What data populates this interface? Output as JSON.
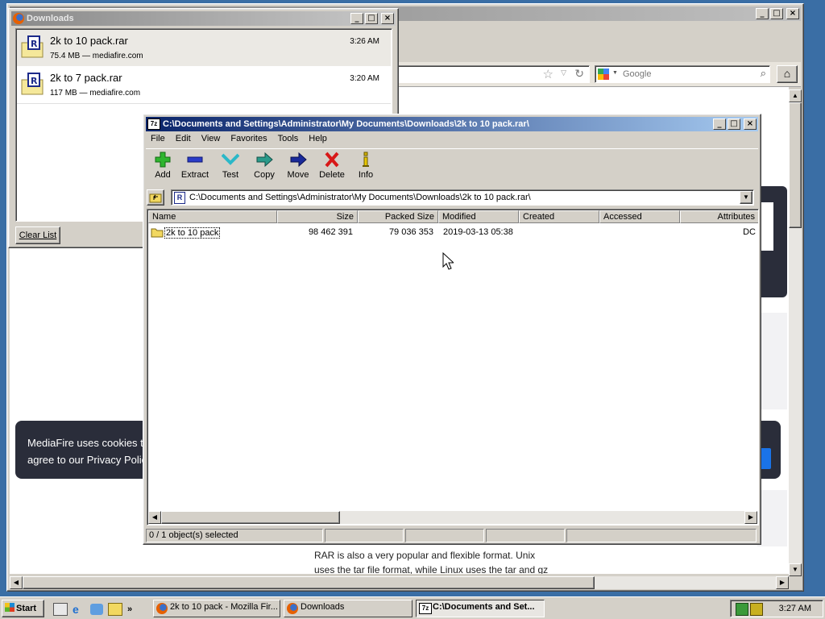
{
  "browser": {
    "search_placeholder": "Google",
    "cookie_line1": "MediaFire uses cookies t",
    "cookie_line2": "agree to our Privacy Polic",
    "article_line1": "RAR is also a very popular and flexible format. Unix",
    "article_line2": "uses the tar file format, while Linux uses the tar and gz"
  },
  "downloads": {
    "title": "Downloads",
    "items": [
      {
        "name": "2k to 10 pack.rar",
        "meta": "75.4 MB — mediafire.com",
        "time": "3:26 AM"
      },
      {
        "name": "2k to 7 pack.rar",
        "meta": "117 MB — mediafire.com",
        "time": "3:20 AM"
      }
    ],
    "clear_label": "Clear List"
  },
  "sevenzip": {
    "title": "C:\\Documents and Settings\\Administrator\\My Documents\\Downloads\\2k to 10 pack.rar\\",
    "menu": [
      "File",
      "Edit",
      "View",
      "Favorites",
      "Tools",
      "Help"
    ],
    "toolbar": [
      "Add",
      "Extract",
      "Test",
      "Copy",
      "Move",
      "Delete",
      "Info"
    ],
    "address": "C:\\Documents and Settings\\Administrator\\My Documents\\Downloads\\2k to 10 pack.rar\\",
    "columns": [
      "Name",
      "Size",
      "Packed Size",
      "Modified",
      "Created",
      "Accessed",
      "Attributes"
    ],
    "rows": [
      {
        "name": "2k to 10 pack",
        "size": "98 462 391",
        "packed": "79 036 353",
        "modified": "2019-03-13 05:38",
        "created": "",
        "accessed": "",
        "attributes": "DC"
      }
    ],
    "status": "0 / 1 object(s) selected"
  },
  "taskbar": {
    "start_label": "Start",
    "tasks": [
      "2k to 10 pack - Mozilla Fir...",
      "Downloads",
      "C:\\Documents and Set..."
    ],
    "clock": "3:27 AM"
  },
  "colors": {
    "titlebar_active": "#0a246a",
    "desktop": "#3a6ea5",
    "cookie_bg": "#2a2d3a"
  }
}
